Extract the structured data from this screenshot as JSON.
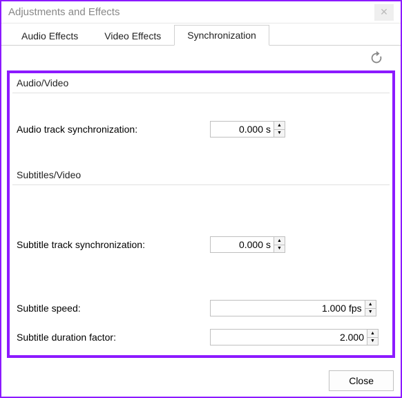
{
  "window": {
    "title": "Adjustments and Effects"
  },
  "tabs": {
    "audio": "Audio Effects",
    "video": "Video Effects",
    "sync": "Synchronization"
  },
  "sync": {
    "group1": "Audio/Video",
    "audio_track_label": "Audio track synchronization:",
    "audio_track_value": "0.000",
    "audio_track_unit": "s",
    "group2": "Subtitles/Video",
    "sub_track_label": "Subtitle track synchronization:",
    "sub_track_value": "0.000",
    "sub_track_unit": "s",
    "sub_speed_label": "Subtitle speed:",
    "sub_speed_value": "1.000",
    "sub_speed_unit": "fps",
    "sub_dur_label": "Subtitle duration factor:",
    "sub_dur_value": "2.000"
  },
  "buttons": {
    "close": "Close"
  }
}
